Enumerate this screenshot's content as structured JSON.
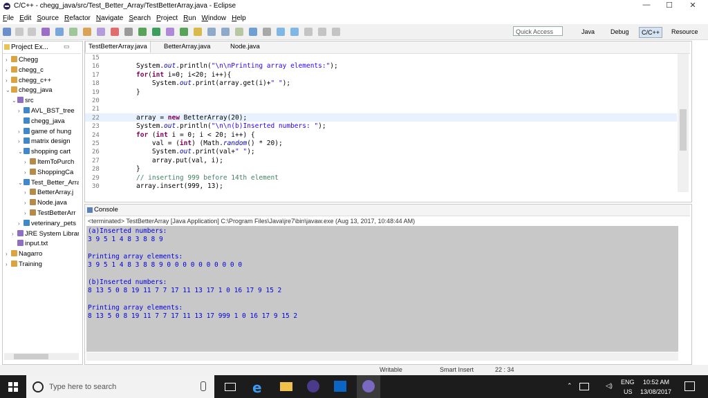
{
  "window": {
    "title": "C/C++ - chegg_java/src/Test_Better_Array/TestBetterArray.java - Eclipse",
    "minimize": "—",
    "maximize": "☐",
    "close": "✕"
  },
  "menu": [
    "File",
    "Edit",
    "Source",
    "Refactor",
    "Navigate",
    "Search",
    "Project",
    "Run",
    "Window",
    "Help"
  ],
  "toolbar": {
    "quick_access": "Quick Access",
    "perspectives": [
      "Java",
      "Debug",
      "C/C++",
      "Resource"
    ]
  },
  "explorer": {
    "title": "Project Ex...",
    "items": [
      {
        "label": "Chegg",
        "indent": 0,
        "twisty": "›"
      },
      {
        "label": "chegg_c",
        "indent": 0,
        "twisty": "›"
      },
      {
        "label": "chegg_c++",
        "indent": 0,
        "twisty": "›"
      },
      {
        "label": "chegg_java",
        "indent": 0,
        "twisty": "⌄"
      },
      {
        "label": "src",
        "indent": 1,
        "twisty": "⌄"
      },
      {
        "label": "AVL_BST_tree",
        "indent": 2,
        "twisty": "›"
      },
      {
        "label": "chegg_java",
        "indent": 2,
        "twisty": ""
      },
      {
        "label": "game of hung",
        "indent": 2,
        "twisty": "›"
      },
      {
        "label": "matrix design",
        "indent": 2,
        "twisty": "›"
      },
      {
        "label": "shopping cart",
        "indent": 2,
        "twisty": "⌄"
      },
      {
        "label": "ItemToPurch",
        "indent": 3,
        "twisty": "›"
      },
      {
        "label": "ShoppingCa",
        "indent": 3,
        "twisty": "›"
      },
      {
        "label": "Test_Better_Arra",
        "indent": 2,
        "twisty": "⌄"
      },
      {
        "label": "BetterArray.j",
        "indent": 3,
        "twisty": "›"
      },
      {
        "label": "Node.java",
        "indent": 3,
        "twisty": "›"
      },
      {
        "label": "TestBetterArr",
        "indent": 3,
        "twisty": "›"
      },
      {
        "label": "veterinary_pets",
        "indent": 2,
        "twisty": "›"
      },
      {
        "label": "JRE System Librar",
        "indent": 1,
        "twisty": "›"
      },
      {
        "label": "input.txt",
        "indent": 1,
        "twisty": ""
      },
      {
        "label": "Nagarro",
        "indent": 0,
        "twisty": "›"
      },
      {
        "label": "Training",
        "indent": 0,
        "twisty": "›"
      }
    ]
  },
  "editor": {
    "tabs": [
      "TestBetterArray.java",
      "BetterArray.java",
      "Node.java"
    ],
    "line_numbers": [
      "15",
      "16",
      "17",
      "18",
      "19",
      "20",
      "21",
      "22",
      "23",
      "24",
      "25",
      "26",
      "27",
      "28",
      "29",
      "30"
    ],
    "lines": [
      [],
      [
        {
          "t": "System."
        },
        {
          "t": "out",
          "c": "fld"
        },
        {
          "t": ".println("
        },
        {
          "t": "\"\\n\\nPrinting array elements:\"",
          "c": "str"
        },
        {
          "t": ");"
        }
      ],
      [
        {
          "t": "for",
          "c": "kw"
        },
        {
          "t": "("
        },
        {
          "t": "int",
          "c": "kw"
        },
        {
          "t": " i=0; i<20; i++){"
        }
      ],
      [
        {
          "t": "    System."
        },
        {
          "t": "out",
          "c": "fld"
        },
        {
          "t": ".print(array.get(i)+"
        },
        {
          "t": "\" \"",
          "c": "str"
        },
        {
          "t": ");"
        }
      ],
      [
        {
          "t": "}"
        }
      ],
      [],
      [],
      [
        {
          "t": "array = "
        },
        {
          "t": "new",
          "c": "kw"
        },
        {
          "t": " BetterArray(20);"
        }
      ],
      [
        {
          "t": "System."
        },
        {
          "t": "out",
          "c": "fld"
        },
        {
          "t": ".println("
        },
        {
          "t": "\"\\n\\n(b)Inserted numbers: \"",
          "c": "str"
        },
        {
          "t": ");"
        }
      ],
      [
        {
          "t": "for",
          "c": "kw"
        },
        {
          "t": " ("
        },
        {
          "t": "int",
          "c": "kw"
        },
        {
          "t": " i = 0; i < 20; i++) {"
        }
      ],
      [
        {
          "t": "    val = ("
        },
        {
          "t": "int",
          "c": "kw"
        },
        {
          "t": ") (Math."
        },
        {
          "t": "random",
          "c": "fld"
        },
        {
          "t": "() * 20);"
        }
      ],
      [
        {
          "t": "    System."
        },
        {
          "t": "out",
          "c": "fld"
        },
        {
          "t": ".print(val+"
        },
        {
          "t": "\" \"",
          "c": "str"
        },
        {
          "t": ");"
        }
      ],
      [
        {
          "t": "    array.put(val, i);"
        }
      ],
      [
        {
          "t": "}"
        }
      ],
      [
        {
          "t": "// inserting 999 before 14th element",
          "c": "cm"
        }
      ],
      [
        {
          "t": "array.insert(999, 13);"
        }
      ]
    ]
  },
  "console": {
    "title": "Console",
    "terminated": "<terminated> TestBetterArray [Java Application] C:\\Program Files\\Java\\jre7\\bin\\javaw.exe (Aug 13, 2017, 10:48:44 AM)",
    "output": [
      "(a)Inserted numbers:",
      "3 9 5 1 4 8 3 8 8 9",
      "",
      "Printing array elements:",
      "3 9 5 1 4 8 3 8 8 9 0 0 0 0 0 0 0 0 0 0",
      "",
      "(b)Inserted numbers:",
      "8 13 5 0 8 19 11 7 7 17 11 13 17 1 0 16 17 9 15 2",
      "",
      "Printing array elements:",
      "8 13 5 0 8 19 11 7 7 17 11 13 17 999 1 0 16 17 9 15 2"
    ]
  },
  "status": {
    "writable": "Writable",
    "insert": "Smart Insert",
    "position": "22 : 34"
  },
  "taskbar": {
    "search_placeholder": "Type here to search",
    "lang": "ENG",
    "region": "US",
    "time": "10:52 AM",
    "date": "13/08/2017"
  },
  "colors": {
    "keyword": "#7f0055",
    "string": "#2a00ff",
    "field": "#0000c0",
    "comment": "#3f7f5f",
    "console_out": "#0000e0"
  }
}
